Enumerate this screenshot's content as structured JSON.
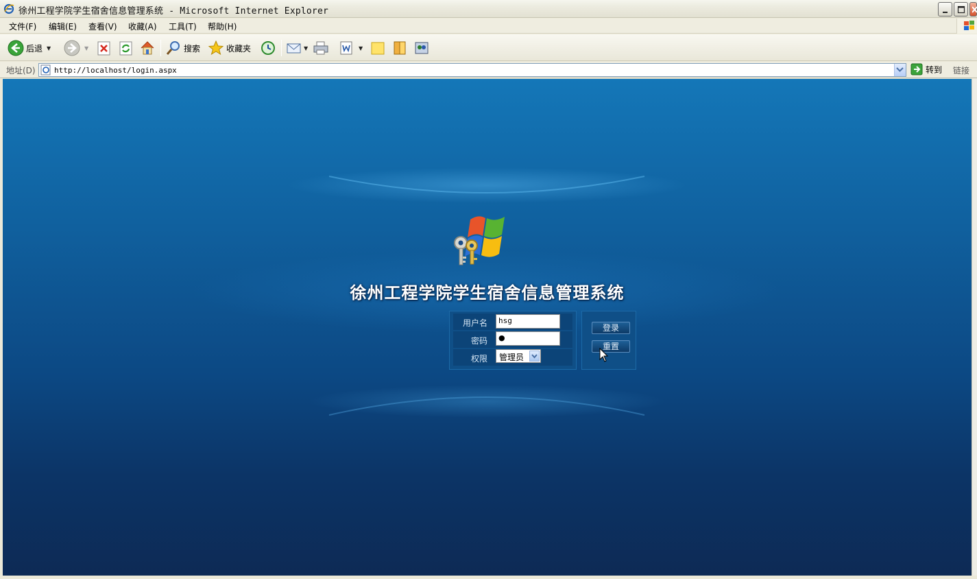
{
  "window": {
    "title": "徐州工程学院学生宿舍信息管理系统 - Microsoft Internet Explorer"
  },
  "menu": {
    "file": "文件(F)",
    "edit": "编辑(E)",
    "view": "查看(V)",
    "favorites": "收藏(A)",
    "tools": "工具(T)",
    "help": "帮助(H)"
  },
  "toolbar": {
    "back": "后退",
    "search": "搜索",
    "favorites": "收藏夹"
  },
  "address": {
    "label": "地址(D)",
    "url": "http://localhost/login.aspx",
    "go": "转到",
    "links": "链接"
  },
  "page": {
    "title": "徐州工程学院学生宿舍信息管理系统",
    "form": {
      "username_label": "用户名",
      "username_value": "hsg",
      "password_label": "密码",
      "password_value": "●",
      "role_label": "权限",
      "role_value": "管理员"
    },
    "buttons": {
      "login": "登录",
      "reset": "重置"
    }
  },
  "colors": {
    "page_top": "#1477b8",
    "page_bottom": "#0d2a55",
    "panel": "#0f4f87"
  }
}
